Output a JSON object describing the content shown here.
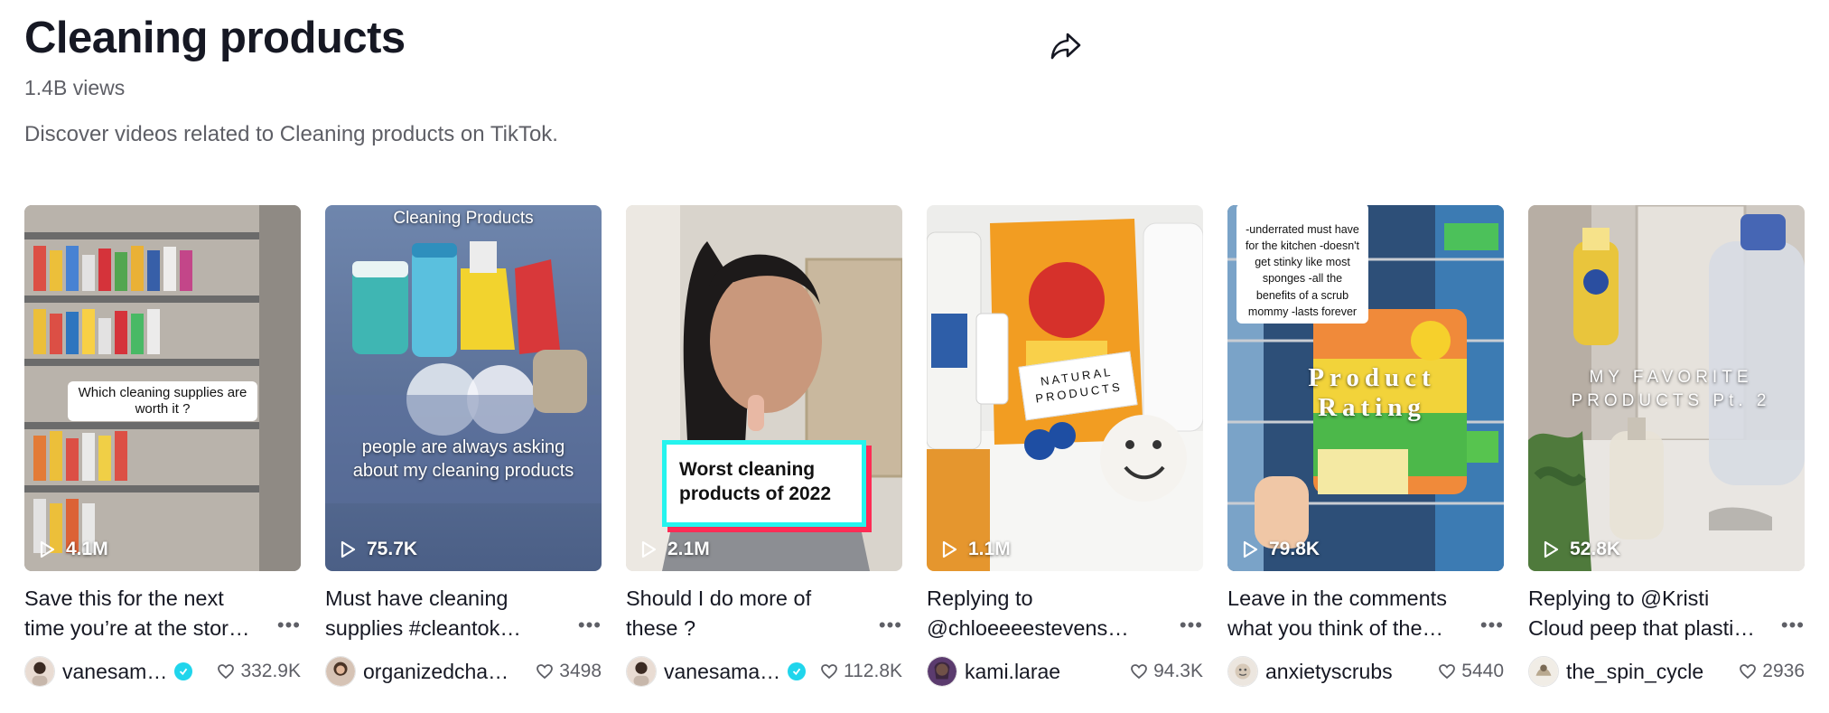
{
  "header": {
    "title": "Cleaning products",
    "views": "1.4B views",
    "description": "Discover videos related to Cleaning products on TikTok.",
    "share_icon": "share-arrow-icon"
  },
  "colors": {
    "verified": "#20d5ec",
    "text": "#161823",
    "muted": "#5e5f66"
  },
  "videos": [
    {
      "play_count": "4.1M",
      "caption": "Save this for the next time you’re at the stor…",
      "author": "vanesam…",
      "verified": true,
      "likes": "332.9K",
      "overlay": "Which cleaning supplies are worth it ?"
    },
    {
      "play_count": "75.7K",
      "caption": "Must have cleaning supplies #cleantok…",
      "author": "organizedcha…",
      "verified": false,
      "likes": "3498",
      "overlay_top": "Cleaning Products",
      "overlay": "people are always asking about my cleaning products"
    },
    {
      "play_count": "2.1M",
      "caption": "Should I do more of these ?",
      "author": "vanesama…",
      "verified": true,
      "likes": "112.8K",
      "overlay": "Worst cleaning products of 2022"
    },
    {
      "play_count": "1.1M",
      "caption": "Replying to @chloeeeestevens…",
      "author": "kami.larae",
      "verified": false,
      "likes": "94.3K",
      "overlay": "NATURAL PRODUCTS"
    },
    {
      "play_count": "79.8K",
      "caption": "Leave in the comments what you think of the…",
      "author": "anxietyscrubs",
      "verified": false,
      "likes": "5440",
      "overlay_top": "-underrated must have for the kitchen -doesn't get stinky like most sponges -all the benefits of a scrub mommy -lasts forever",
      "overlay": "Product Rating"
    },
    {
      "play_count": "52.8K",
      "caption": "Replying to @Kristi Cloud peep that plasti…",
      "author": "the_spin_cycle",
      "verified": false,
      "likes": "2936",
      "overlay": "MY FAVORITE PRODUCTS Pt. 2"
    }
  ]
}
